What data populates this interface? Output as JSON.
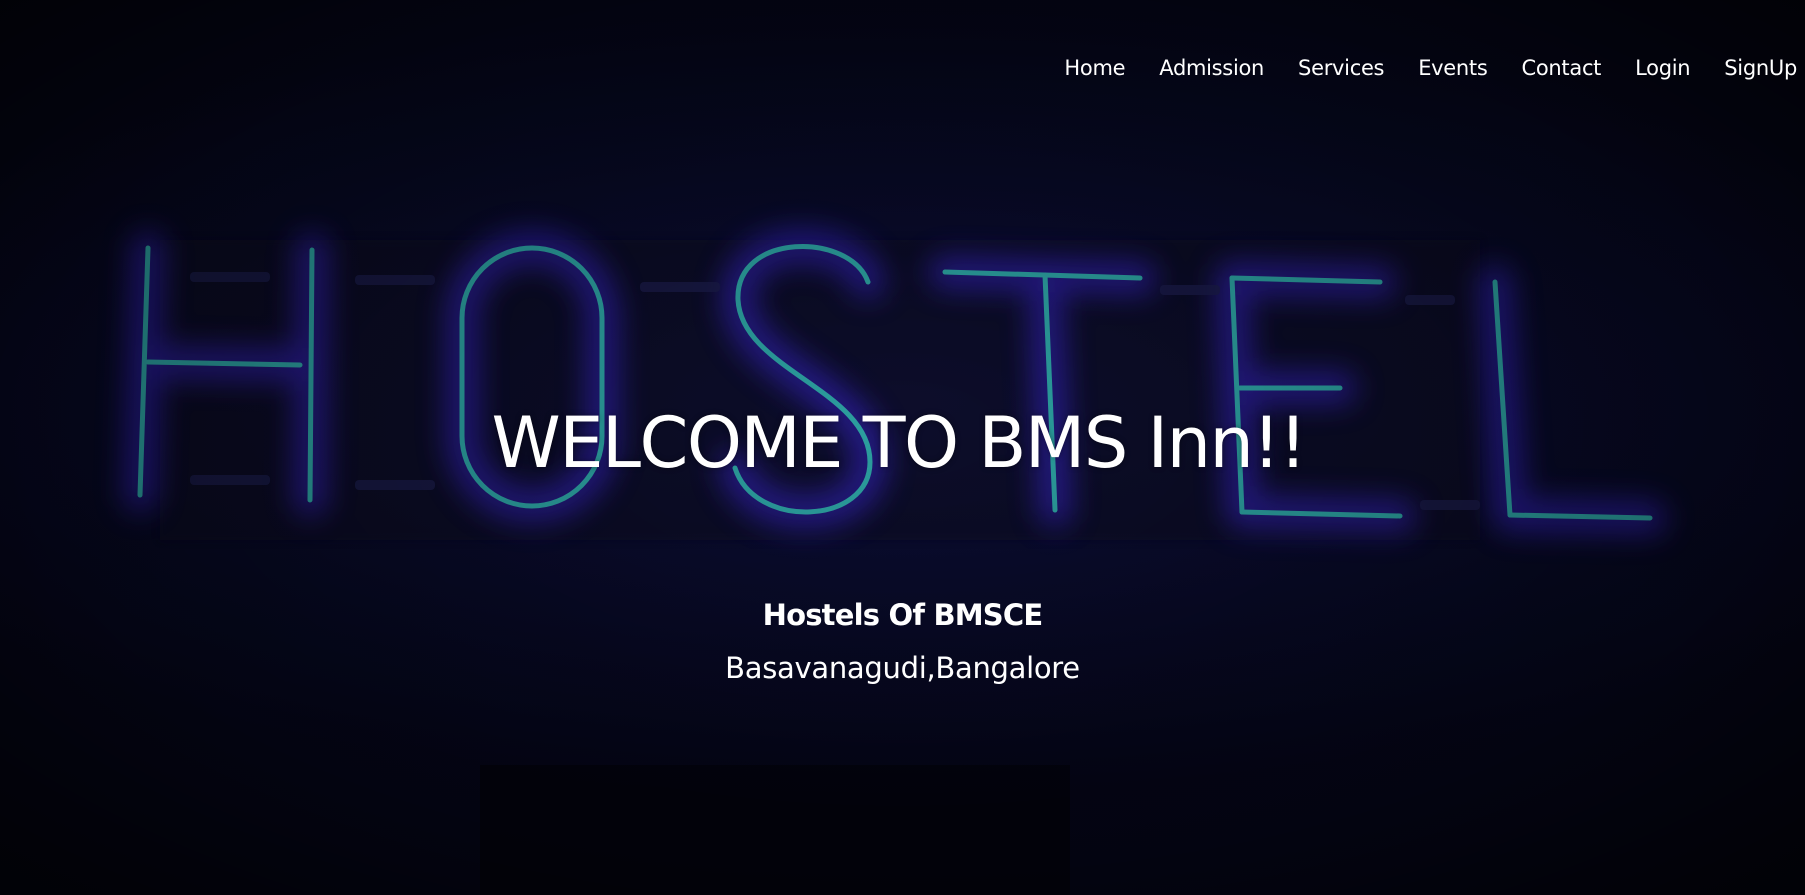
{
  "nav": {
    "items": [
      {
        "label": "Home"
      },
      {
        "label": "Admission"
      },
      {
        "label": "Services"
      },
      {
        "label": "Events"
      },
      {
        "label": "Contact"
      },
      {
        "label": "Login"
      },
      {
        "label": "SignUp"
      }
    ]
  },
  "hero": {
    "background_text": "HOSTEL",
    "title": "WELCOME TO BMS Inn!!",
    "subtitle": "Hostels Of BMSCE",
    "location": "Basavanagudi,Bangalore"
  },
  "colors": {
    "background": "#05061a",
    "neon_tube": "#2fb8a8",
    "neon_glow": "#3a2ad0",
    "text": "#ffffff"
  }
}
